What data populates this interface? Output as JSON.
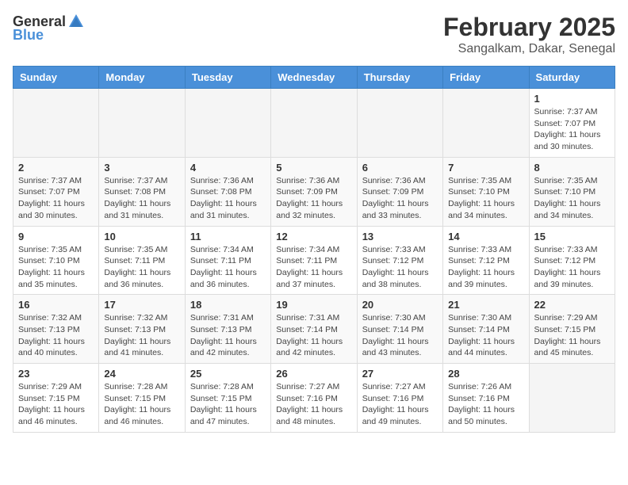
{
  "header": {
    "logo_general": "General",
    "logo_blue": "Blue",
    "month": "February 2025",
    "location": "Sangalkam, Dakar, Senegal"
  },
  "days_of_week": [
    "Sunday",
    "Monday",
    "Tuesday",
    "Wednesday",
    "Thursday",
    "Friday",
    "Saturday"
  ],
  "weeks": [
    [
      {
        "day": "",
        "info": ""
      },
      {
        "day": "",
        "info": ""
      },
      {
        "day": "",
        "info": ""
      },
      {
        "day": "",
        "info": ""
      },
      {
        "day": "",
        "info": ""
      },
      {
        "day": "",
        "info": ""
      },
      {
        "day": "1",
        "info": "Sunrise: 7:37 AM\nSunset: 7:07 PM\nDaylight: 11 hours\nand 30 minutes."
      }
    ],
    [
      {
        "day": "2",
        "info": "Sunrise: 7:37 AM\nSunset: 7:07 PM\nDaylight: 11 hours\nand 30 minutes."
      },
      {
        "day": "3",
        "info": "Sunrise: 7:37 AM\nSunset: 7:08 PM\nDaylight: 11 hours\nand 31 minutes."
      },
      {
        "day": "4",
        "info": "Sunrise: 7:36 AM\nSunset: 7:08 PM\nDaylight: 11 hours\nand 31 minutes."
      },
      {
        "day": "5",
        "info": "Sunrise: 7:36 AM\nSunset: 7:09 PM\nDaylight: 11 hours\nand 32 minutes."
      },
      {
        "day": "6",
        "info": "Sunrise: 7:36 AM\nSunset: 7:09 PM\nDaylight: 11 hours\nand 33 minutes."
      },
      {
        "day": "7",
        "info": "Sunrise: 7:35 AM\nSunset: 7:10 PM\nDaylight: 11 hours\nand 34 minutes."
      },
      {
        "day": "8",
        "info": "Sunrise: 7:35 AM\nSunset: 7:10 PM\nDaylight: 11 hours\nand 34 minutes."
      }
    ],
    [
      {
        "day": "9",
        "info": "Sunrise: 7:35 AM\nSunset: 7:10 PM\nDaylight: 11 hours\nand 35 minutes."
      },
      {
        "day": "10",
        "info": "Sunrise: 7:35 AM\nSunset: 7:11 PM\nDaylight: 11 hours\nand 36 minutes."
      },
      {
        "day": "11",
        "info": "Sunrise: 7:34 AM\nSunset: 7:11 PM\nDaylight: 11 hours\nand 36 minutes."
      },
      {
        "day": "12",
        "info": "Sunrise: 7:34 AM\nSunset: 7:11 PM\nDaylight: 11 hours\nand 37 minutes."
      },
      {
        "day": "13",
        "info": "Sunrise: 7:33 AM\nSunset: 7:12 PM\nDaylight: 11 hours\nand 38 minutes."
      },
      {
        "day": "14",
        "info": "Sunrise: 7:33 AM\nSunset: 7:12 PM\nDaylight: 11 hours\nand 39 minutes."
      },
      {
        "day": "15",
        "info": "Sunrise: 7:33 AM\nSunset: 7:12 PM\nDaylight: 11 hours\nand 39 minutes."
      }
    ],
    [
      {
        "day": "16",
        "info": "Sunrise: 7:32 AM\nSunset: 7:13 PM\nDaylight: 11 hours\nand 40 minutes."
      },
      {
        "day": "17",
        "info": "Sunrise: 7:32 AM\nSunset: 7:13 PM\nDaylight: 11 hours\nand 41 minutes."
      },
      {
        "day": "18",
        "info": "Sunrise: 7:31 AM\nSunset: 7:13 PM\nDaylight: 11 hours\nand 42 minutes."
      },
      {
        "day": "19",
        "info": "Sunrise: 7:31 AM\nSunset: 7:14 PM\nDaylight: 11 hours\nand 42 minutes."
      },
      {
        "day": "20",
        "info": "Sunrise: 7:30 AM\nSunset: 7:14 PM\nDaylight: 11 hours\nand 43 minutes."
      },
      {
        "day": "21",
        "info": "Sunrise: 7:30 AM\nSunset: 7:14 PM\nDaylight: 11 hours\nand 44 minutes."
      },
      {
        "day": "22",
        "info": "Sunrise: 7:29 AM\nSunset: 7:15 PM\nDaylight: 11 hours\nand 45 minutes."
      }
    ],
    [
      {
        "day": "23",
        "info": "Sunrise: 7:29 AM\nSunset: 7:15 PM\nDaylight: 11 hours\nand 46 minutes."
      },
      {
        "day": "24",
        "info": "Sunrise: 7:28 AM\nSunset: 7:15 PM\nDaylight: 11 hours\nand 46 minutes."
      },
      {
        "day": "25",
        "info": "Sunrise: 7:28 AM\nSunset: 7:15 PM\nDaylight: 11 hours\nand 47 minutes."
      },
      {
        "day": "26",
        "info": "Sunrise: 7:27 AM\nSunset: 7:16 PM\nDaylight: 11 hours\nand 48 minutes."
      },
      {
        "day": "27",
        "info": "Sunrise: 7:27 AM\nSunset: 7:16 PM\nDaylight: 11 hours\nand 49 minutes."
      },
      {
        "day": "28",
        "info": "Sunrise: 7:26 AM\nSunset: 7:16 PM\nDaylight: 11 hours\nand 50 minutes."
      },
      {
        "day": "",
        "info": ""
      }
    ]
  ]
}
